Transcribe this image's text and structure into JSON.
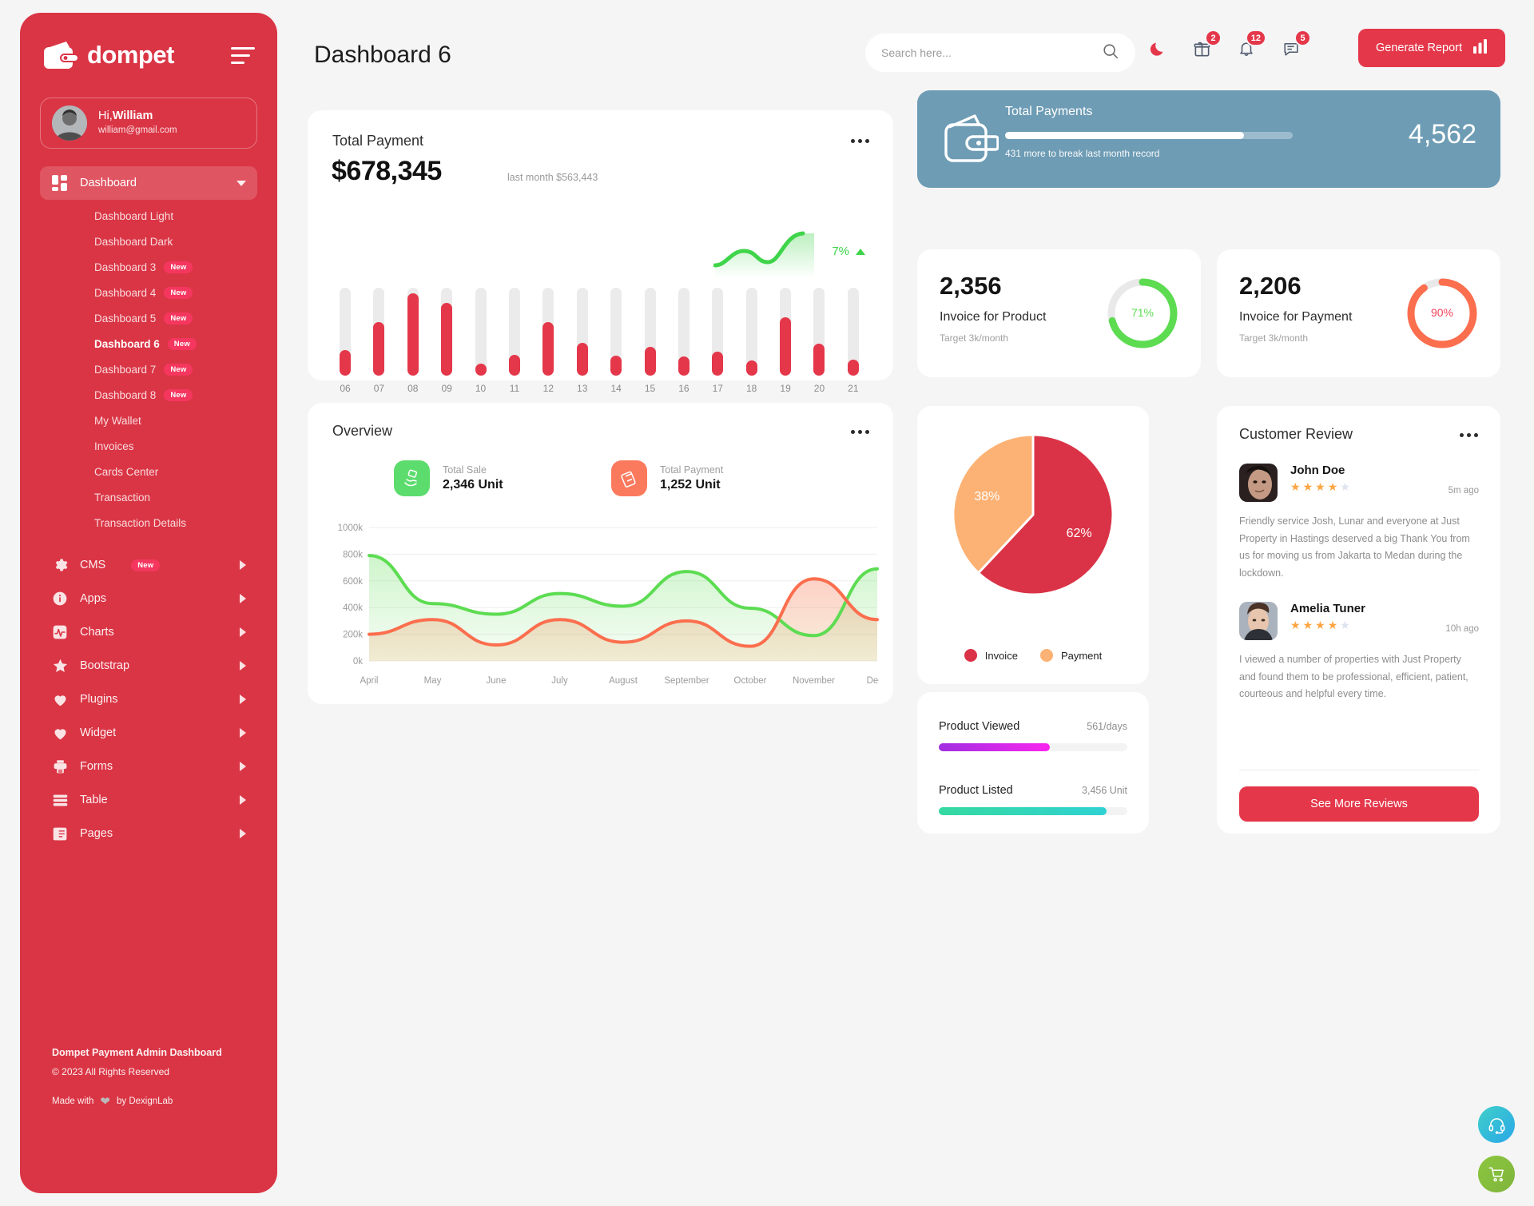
{
  "brand": {
    "name": "dompet",
    "logo_icon": "wallet-icon",
    "menu_icon": "hamburger-icon"
  },
  "profile": {
    "greeting_prefix": "Hi,",
    "name": "William",
    "email": "william@gmail.com"
  },
  "sidebar": {
    "dashboard_item": {
      "label": "Dashboard",
      "icon": "grid-icon"
    },
    "submenu": [
      {
        "label": "Dashboard Light",
        "badge": ""
      },
      {
        "label": "Dashboard Dark",
        "badge": ""
      },
      {
        "label": "Dashboard 3",
        "badge": "New"
      },
      {
        "label": "Dashboard 4",
        "badge": "New"
      },
      {
        "label": "Dashboard 5",
        "badge": "New"
      },
      {
        "label": "Dashboard 6",
        "badge": "New"
      },
      {
        "label": "Dashboard 7",
        "badge": "New"
      },
      {
        "label": "Dashboard 8",
        "badge": "New"
      },
      {
        "label": "My Wallet",
        "badge": ""
      },
      {
        "label": "Invoices",
        "badge": ""
      },
      {
        "label": "Cards Center",
        "badge": ""
      },
      {
        "label": "Transaction",
        "badge": ""
      },
      {
        "label": "Transaction Details",
        "badge": ""
      }
    ],
    "groups": [
      {
        "label": "CMS",
        "icon": "gear-icon",
        "badge": "New"
      },
      {
        "label": "Apps",
        "icon": "info-icon",
        "badge": ""
      },
      {
        "label": "Charts",
        "icon": "chart-pulse-icon",
        "badge": ""
      },
      {
        "label": "Bootstrap",
        "icon": "star-icon",
        "badge": ""
      },
      {
        "label": "Plugins",
        "icon": "heart-icon",
        "badge": ""
      },
      {
        "label": "Widget",
        "icon": "heart-icon",
        "badge": ""
      },
      {
        "label": "Forms",
        "icon": "printer-icon",
        "badge": ""
      },
      {
        "label": "Table",
        "icon": "table-icon",
        "badge": ""
      },
      {
        "label": "Pages",
        "icon": "pages-icon",
        "badge": ""
      }
    ],
    "footer": {
      "title": "Dompet Payment Admin Dashboard",
      "copyright": "© 2023 All Rights Reserved",
      "made_prefix": "Made with",
      "made_suffix": "by DexignLab"
    }
  },
  "header": {
    "title": "Dashboard 6",
    "search_placeholder": "Search here...",
    "search_value": "",
    "search_icon": "search-icon",
    "dark_mode_icon": "moon-icon",
    "icons": [
      {
        "name": "gift-icon",
        "badge": "2"
      },
      {
        "name": "bell-icon",
        "badge": "12"
      },
      {
        "name": "message-icon",
        "badge": "5"
      }
    ],
    "generate_report": {
      "label": "Generate Report",
      "icon": "bar-chart-icon"
    }
  },
  "total_payment": {
    "title": "Total Payment",
    "amount": "$678,345",
    "last_month": "last month $563,443",
    "percent": "7%",
    "trend": "up",
    "more_icon": "more-options-icon"
  },
  "payments_banner": {
    "title": "Total Payments",
    "value": "4,562",
    "note": "431 more to break last month record",
    "progress_percent": 83,
    "icon": "wallet-icon",
    "color": "#6e9cb5"
  },
  "invoice_cards": [
    {
      "number": "2,356",
      "label": "Invoice for Product",
      "target": "Target 3k/month",
      "percent": "71%",
      "percent_value": 71,
      "color": "#5ddc52"
    },
    {
      "number": "2,206",
      "label": "Invoice for Payment",
      "target": "Target 3k/month",
      "percent": "90%",
      "percent_value": 90,
      "color": "#fb6e4e"
    }
  ],
  "overview": {
    "title": "Overview",
    "more_icon": "more-options-icon",
    "stats": [
      {
        "label": "Total Sale",
        "value": "2,346 Unit",
        "icon": "hand-money-icon",
        "color": "#5ddc6e"
      },
      {
        "label": "Total Payment",
        "value": "1,252 Unit",
        "icon": "card-terminal-icon",
        "color": "#fb7a5e"
      }
    ]
  },
  "products": {
    "rows": [
      {
        "name": "Product Viewed",
        "value": "561/days",
        "percent": 59,
        "color_from": "#a12ee0",
        "color_to": "#f925ef"
      },
      {
        "name": "Product Listed",
        "value": "3,456 Unit",
        "percent": 89,
        "color_from": "#36d9a0",
        "color_to": "#2fd2d2"
      }
    ]
  },
  "review": {
    "title": "Customer Review",
    "more_icon": "more-options-icon",
    "items": [
      {
        "name": "John Doe",
        "time": "5m ago",
        "stars": 4,
        "max_stars": 5,
        "text": "Friendly service Josh, Lunar and everyone at Just Property in Hastings deserved a big Thank You from us for moving us from Jakarta to Medan during the lockdown."
      },
      {
        "name": "Amelia Tuner",
        "time": "10h ago",
        "stars": 4,
        "max_stars": 5,
        "text": "I viewed a number of properties with Just Property and found them to be professional, efficient, patient, courteous and helpful every time."
      }
    ],
    "see_more_label": "See More Reviews"
  },
  "fabs": [
    {
      "name": "support-headset-icon"
    },
    {
      "name": "shopping-cart-icon"
    }
  ],
  "chart_data": [
    {
      "type": "bar",
      "title": "Total Payment",
      "categories": [
        "06",
        "07",
        "08",
        "09",
        "10",
        "11",
        "12",
        "13",
        "14",
        "15",
        "16",
        "17",
        "18",
        "19",
        "20",
        "21"
      ],
      "values": [
        29,
        61,
        94,
        83,
        14,
        24,
        61,
        37,
        23,
        33,
        22,
        27,
        17,
        66,
        36,
        18
      ],
      "track_max": 100,
      "ylim": [
        0,
        100
      ],
      "xlabel": "",
      "ylabel": "",
      "grid": false,
      "colors": {
        "bar": "#e4374a",
        "track": "#ebebeb"
      }
    },
    {
      "type": "area",
      "title": "Overview",
      "x": [
        "April",
        "May",
        "June",
        "July",
        "August",
        "September",
        "October",
        "November",
        "Dec.."
      ],
      "series": [
        {
          "name": "Total Sale",
          "color": "#5ddc52",
          "values": [
            790,
            430,
            350,
            505,
            410,
            670,
            395,
            190,
            690
          ]
        },
        {
          "name": "Total Payment",
          "color": "#fb6e4e",
          "values": [
            200,
            310,
            120,
            310,
            140,
            300,
            110,
            615,
            310
          ]
        }
      ],
      "yticks": [
        "0k",
        "200k",
        "400k",
        "600k",
        "800k",
        "1000k"
      ],
      "ylim": [
        0,
        1000
      ],
      "xlabel": "",
      "ylabel": "",
      "grid": true,
      "legend": "none"
    },
    {
      "type": "pie",
      "title": "",
      "labels": [
        "Invoice",
        "Payment"
      ],
      "values": [
        62,
        38
      ],
      "value_labels": [
        "62%",
        "38%"
      ],
      "colors": [
        "#da3347",
        "#fcb274"
      ],
      "legend": "bottom"
    }
  ]
}
